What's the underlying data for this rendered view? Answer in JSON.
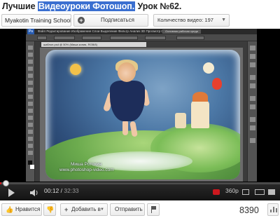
{
  "title": {
    "prefix": "Лучшие ",
    "highlight": "Видеоуроки Фотошоп.",
    "suffix": " Урок №62."
  },
  "channel": {
    "name": "Myakotin Training School",
    "subscribe_label": "Подписаться",
    "videos_count_label": "Количество видео: 197"
  },
  "photoshop": {
    "logo": "Ps",
    "menu": "Файл  Редактирование  Изображение  Слои  Выделение  Фильтр  Анализ  3D  Просмотр  Окно  Справка",
    "workspace": "Основная рабочая среда",
    "doc_tab": "шаблон.psd @ 50% (Миша копия, RGB/8)"
  },
  "watermark": {
    "name": "Миша Ротохин",
    "site": "www.photoshop-video.com"
  },
  "player": {
    "current_time": "00:12",
    "duration": "32:33",
    "quality": "360p",
    "progress_fraction": 0.006,
    "accent_color": "#cc181e"
  },
  "actions": {
    "like_label": "Нравится",
    "add_label": "Добавить в",
    "share_label": "Отправить",
    "views": "8390"
  },
  "icons": {
    "like": "thumbs-up-icon",
    "dislike": "thumbs-down-icon",
    "add": "plus-icon",
    "flag": "flag-icon",
    "stats": "bar-chart-icon"
  }
}
